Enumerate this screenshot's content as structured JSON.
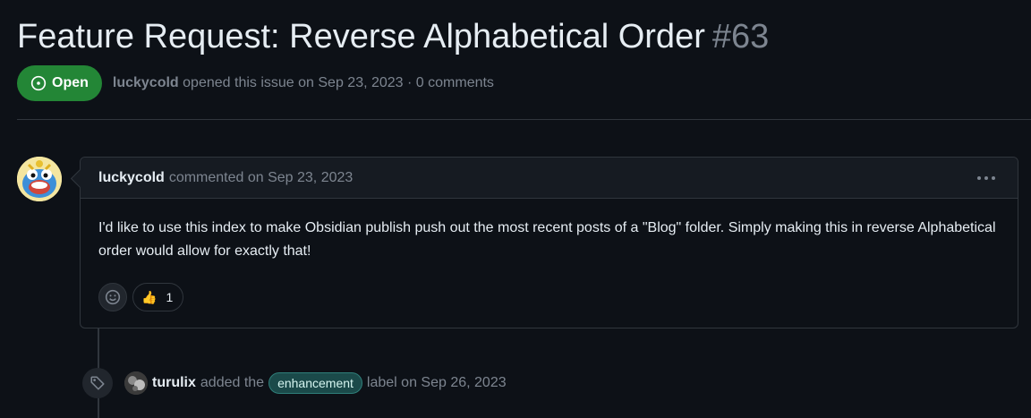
{
  "issue": {
    "title": "Feature Request: Reverse Alphabetical Order",
    "number": "#63",
    "state_label": "Open",
    "author": "luckycold",
    "opened_text": "opened this issue on Sep 23, 2023 · 0 comments"
  },
  "comment": {
    "author": "luckycold",
    "action_text": "commented on Sep 23, 2023",
    "body": "I'd like to use this index to make Obsidian publish push out the most recent posts of a \"Blog\" folder. Simply making this in reverse Alphabetical order would allow for exactly that!",
    "reactions": [
      {
        "emoji": "👍",
        "count": "1"
      }
    ]
  },
  "event": {
    "actor": "turulix",
    "pre_text": "added the",
    "label": "enhancement",
    "post_text": "label on Sep 26, 2023"
  },
  "colors": {
    "background": "#0d1117",
    "open_badge": "#238636",
    "label_bg": "#1b4a4a",
    "label_border": "#2f7f7a"
  },
  "icons": {
    "state": "issue-opened-icon",
    "kebab": "kebab-horizontal-icon",
    "reaction_add": "smiley-icon",
    "event": "tag-icon"
  }
}
